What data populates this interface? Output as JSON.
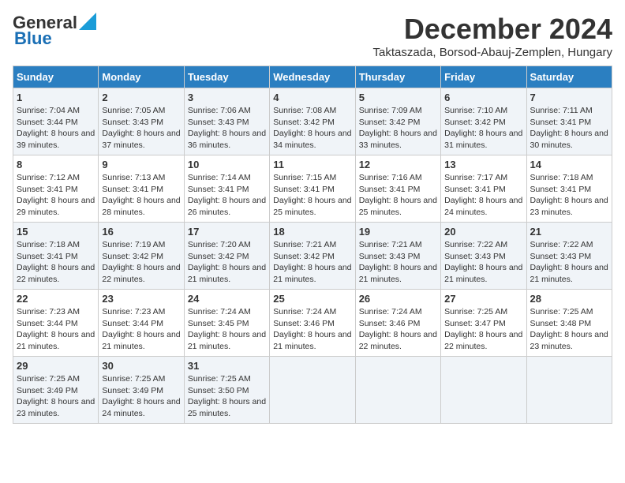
{
  "header": {
    "logo_general": "General",
    "logo_blue": "Blue",
    "title": "December 2024",
    "location": "Taktaszada, Borsod-Abauj-Zemplen, Hungary"
  },
  "days_of_week": [
    "Sunday",
    "Monday",
    "Tuesday",
    "Wednesday",
    "Thursday",
    "Friday",
    "Saturday"
  ],
  "weeks": [
    [
      {
        "day": "1",
        "sunrise": "7:04 AM",
        "sunset": "3:44 PM",
        "daylight": "8 hours and 39 minutes."
      },
      {
        "day": "2",
        "sunrise": "7:05 AM",
        "sunset": "3:43 PM",
        "daylight": "8 hours and 37 minutes."
      },
      {
        "day": "3",
        "sunrise": "7:06 AM",
        "sunset": "3:43 PM",
        "daylight": "8 hours and 36 minutes."
      },
      {
        "day": "4",
        "sunrise": "7:08 AM",
        "sunset": "3:42 PM",
        "daylight": "8 hours and 34 minutes."
      },
      {
        "day": "5",
        "sunrise": "7:09 AM",
        "sunset": "3:42 PM",
        "daylight": "8 hours and 33 minutes."
      },
      {
        "day": "6",
        "sunrise": "7:10 AM",
        "sunset": "3:42 PM",
        "daylight": "8 hours and 31 minutes."
      },
      {
        "day": "7",
        "sunrise": "7:11 AM",
        "sunset": "3:41 PM",
        "daylight": "8 hours and 30 minutes."
      }
    ],
    [
      {
        "day": "8",
        "sunrise": "7:12 AM",
        "sunset": "3:41 PM",
        "daylight": "8 hours and 29 minutes."
      },
      {
        "day": "9",
        "sunrise": "7:13 AM",
        "sunset": "3:41 PM",
        "daylight": "8 hours and 28 minutes."
      },
      {
        "day": "10",
        "sunrise": "7:14 AM",
        "sunset": "3:41 PM",
        "daylight": "8 hours and 26 minutes."
      },
      {
        "day": "11",
        "sunrise": "7:15 AM",
        "sunset": "3:41 PM",
        "daylight": "8 hours and 25 minutes."
      },
      {
        "day": "12",
        "sunrise": "7:16 AM",
        "sunset": "3:41 PM",
        "daylight": "8 hours and 25 minutes."
      },
      {
        "day": "13",
        "sunrise": "7:17 AM",
        "sunset": "3:41 PM",
        "daylight": "8 hours and 24 minutes."
      },
      {
        "day": "14",
        "sunrise": "7:18 AM",
        "sunset": "3:41 PM",
        "daylight": "8 hours and 23 minutes."
      }
    ],
    [
      {
        "day": "15",
        "sunrise": "7:18 AM",
        "sunset": "3:41 PM",
        "daylight": "8 hours and 22 minutes."
      },
      {
        "day": "16",
        "sunrise": "7:19 AM",
        "sunset": "3:42 PM",
        "daylight": "8 hours and 22 minutes."
      },
      {
        "day": "17",
        "sunrise": "7:20 AM",
        "sunset": "3:42 PM",
        "daylight": "8 hours and 21 minutes."
      },
      {
        "day": "18",
        "sunrise": "7:21 AM",
        "sunset": "3:42 PM",
        "daylight": "8 hours and 21 minutes."
      },
      {
        "day": "19",
        "sunrise": "7:21 AM",
        "sunset": "3:43 PM",
        "daylight": "8 hours and 21 minutes."
      },
      {
        "day": "20",
        "sunrise": "7:22 AM",
        "sunset": "3:43 PM",
        "daylight": "8 hours and 21 minutes."
      },
      {
        "day": "21",
        "sunrise": "7:22 AM",
        "sunset": "3:43 PM",
        "daylight": "8 hours and 21 minutes."
      }
    ],
    [
      {
        "day": "22",
        "sunrise": "7:23 AM",
        "sunset": "3:44 PM",
        "daylight": "8 hours and 21 minutes."
      },
      {
        "day": "23",
        "sunrise": "7:23 AM",
        "sunset": "3:44 PM",
        "daylight": "8 hours and 21 minutes."
      },
      {
        "day": "24",
        "sunrise": "7:24 AM",
        "sunset": "3:45 PM",
        "daylight": "8 hours and 21 minutes."
      },
      {
        "day": "25",
        "sunrise": "7:24 AM",
        "sunset": "3:46 PM",
        "daylight": "8 hours and 21 minutes."
      },
      {
        "day": "26",
        "sunrise": "7:24 AM",
        "sunset": "3:46 PM",
        "daylight": "8 hours and 22 minutes."
      },
      {
        "day": "27",
        "sunrise": "7:25 AM",
        "sunset": "3:47 PM",
        "daylight": "8 hours and 22 minutes."
      },
      {
        "day": "28",
        "sunrise": "7:25 AM",
        "sunset": "3:48 PM",
        "daylight": "8 hours and 23 minutes."
      }
    ],
    [
      {
        "day": "29",
        "sunrise": "7:25 AM",
        "sunset": "3:49 PM",
        "daylight": "8 hours and 23 minutes."
      },
      {
        "day": "30",
        "sunrise": "7:25 AM",
        "sunset": "3:49 PM",
        "daylight": "8 hours and 24 minutes."
      },
      {
        "day": "31",
        "sunrise": "7:25 AM",
        "sunset": "3:50 PM",
        "daylight": "8 hours and 25 minutes."
      },
      null,
      null,
      null,
      null
    ]
  ]
}
